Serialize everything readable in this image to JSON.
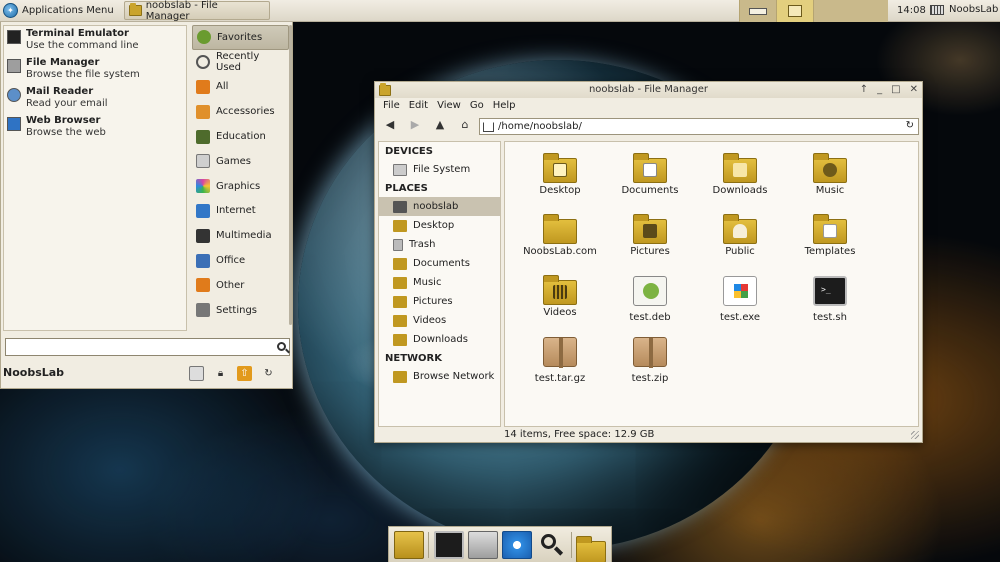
{
  "top_panel": {
    "apps_label": "Applications Menu",
    "task_label": "noobslab - File Manager",
    "clock": "14:08",
    "user": "NoobsLab"
  },
  "app_menu": {
    "favorites": [
      {
        "title": "Terminal Emulator",
        "subtitle": "Use the command line",
        "icon": "terminal-icon",
        "color": "#222222"
      },
      {
        "title": "File Manager",
        "subtitle": "Browse the file system",
        "icon": "file-manager-icon",
        "color": "#9e9e9e"
      },
      {
        "title": "Mail Reader",
        "subtitle": "Read your email",
        "icon": "mail-icon",
        "color": "#5c8fc9"
      },
      {
        "title": "Web Browser",
        "subtitle": "Browse the web",
        "icon": "web-browser-icon",
        "color": "#2f73c4"
      }
    ],
    "categories": [
      {
        "label": "Favorites",
        "icon": "favorites-icon",
        "color": "#6a9b2f"
      },
      {
        "label": "Recently Used",
        "icon": "recent-icon",
        "color": "#555555"
      },
      {
        "label": "All",
        "icon": "all-icon",
        "color": "#e07b1b"
      },
      {
        "label": "Accessories",
        "icon": "accessories-icon",
        "color": "#e0902b"
      },
      {
        "label": "Education",
        "icon": "education-icon",
        "color": "#4e6b2c"
      },
      {
        "label": "Games",
        "icon": "games-icon",
        "color": "#cfcfcf"
      },
      {
        "label": "Graphics",
        "icon": "graphics-icon",
        "color": "#d843a5"
      },
      {
        "label": "Internet",
        "icon": "internet-icon",
        "color": "#3277c7"
      },
      {
        "label": "Multimedia",
        "icon": "multimedia-icon",
        "color": "#333333"
      },
      {
        "label": "Office",
        "icon": "office-icon",
        "color": "#3b6fb6"
      },
      {
        "label": "Other",
        "icon": "other-icon",
        "color": "#e07b1b"
      },
      {
        "label": "Settings",
        "icon": "settings-icon",
        "color": "#777777"
      }
    ],
    "search_value": "",
    "user": "NoobsLab"
  },
  "file_manager": {
    "title": "noobslab - File Manager",
    "menus": [
      "File",
      "Edit",
      "View",
      "Go",
      "Help"
    ],
    "path": "/home/noobslab/",
    "sidebar": {
      "devices_heading": "DEVICES",
      "devices": [
        {
          "label": "File System",
          "icon": "drive-icon"
        }
      ],
      "places_heading": "PLACES",
      "places": [
        {
          "label": "noobslab",
          "icon": "home-icon"
        },
        {
          "label": "Desktop",
          "icon": "desktop-folder-icon"
        },
        {
          "label": "Trash",
          "icon": "trash-icon"
        },
        {
          "label": "Documents",
          "icon": "documents-folder-icon"
        },
        {
          "label": "Music",
          "icon": "music-folder-icon"
        },
        {
          "label": "Pictures",
          "icon": "pictures-folder-icon"
        },
        {
          "label": "Videos",
          "icon": "videos-folder-icon"
        },
        {
          "label": "Downloads",
          "icon": "downloads-folder-icon"
        }
      ],
      "network_heading": "NETWORK",
      "network": [
        {
          "label": "Browse Network",
          "icon": "network-icon"
        }
      ]
    },
    "items": [
      {
        "label": "Desktop",
        "type": "folder",
        "icon": "desktop-folder-icon"
      },
      {
        "label": "Documents",
        "type": "folder",
        "icon": "documents-folder-icon"
      },
      {
        "label": "Downloads",
        "type": "folder",
        "icon": "downloads-folder-icon"
      },
      {
        "label": "Music",
        "type": "folder",
        "icon": "music-folder-icon"
      },
      {
        "label": "NoobsLab.com",
        "type": "folder",
        "icon": "folder-icon"
      },
      {
        "label": "Pictures",
        "type": "folder",
        "icon": "pictures-folder-icon"
      },
      {
        "label": "Public",
        "type": "folder",
        "icon": "public-folder-icon"
      },
      {
        "label": "Templates",
        "type": "folder",
        "icon": "templates-folder-icon"
      },
      {
        "label": "Videos",
        "type": "folder",
        "icon": "videos-folder-icon"
      },
      {
        "label": "test.deb",
        "type": "deb",
        "icon": "deb-package-icon"
      },
      {
        "label": "test.exe",
        "type": "exe",
        "icon": "exe-file-icon"
      },
      {
        "label": "test.sh",
        "type": "sh",
        "icon": "shell-script-icon"
      },
      {
        "label": "test.tar.gz",
        "type": "box",
        "icon": "archive-icon"
      },
      {
        "label": "test.zip",
        "type": "box",
        "icon": "archive-icon"
      }
    ],
    "status": "14 items, Free space: 12.9 GB"
  },
  "dock": {
    "items": [
      {
        "icon": "show-desktop-icon"
      },
      {
        "icon": "terminal-icon"
      },
      {
        "icon": "file-manager-icon"
      },
      {
        "icon": "web-browser-icon"
      },
      {
        "icon": "search-icon"
      },
      {
        "icon": "home-folder-icon"
      }
    ]
  }
}
